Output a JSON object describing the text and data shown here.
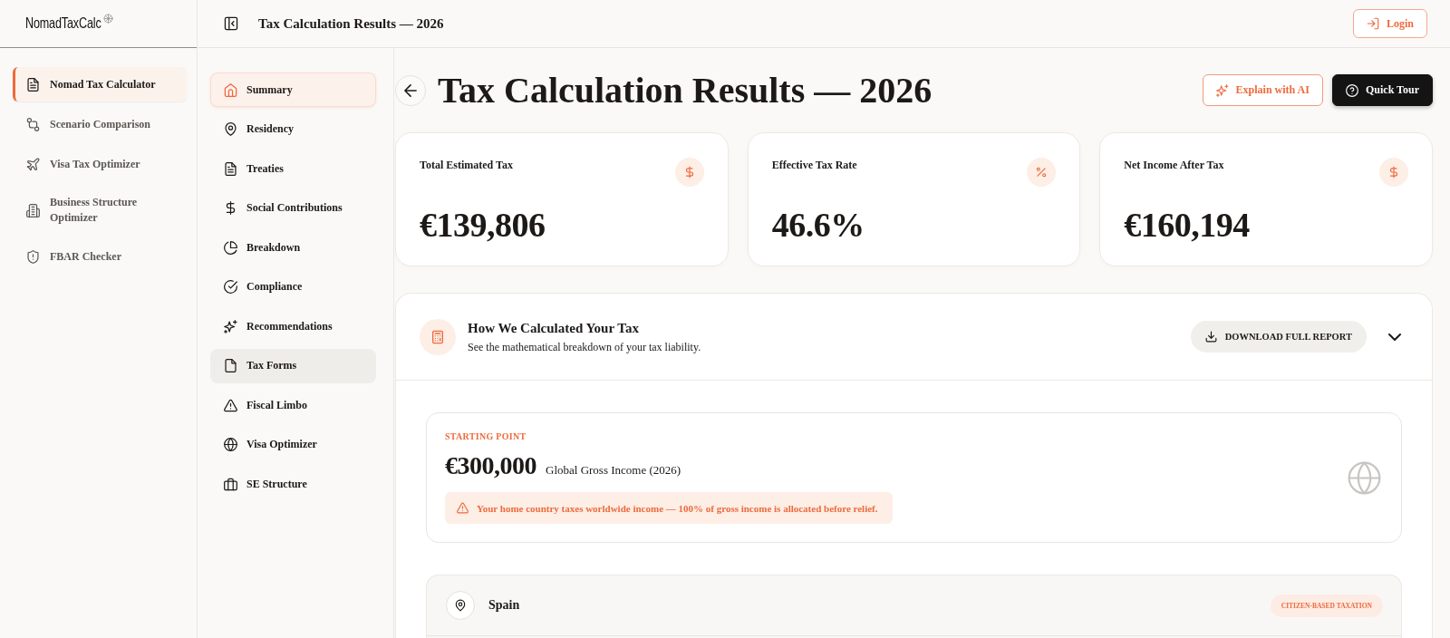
{
  "sidebar": {
    "logo": "NomadTaxCalc",
    "items": [
      {
        "label": "Nomad Tax Calculator",
        "selected": true
      },
      {
        "label": "Scenario Comparison",
        "selected": false
      },
      {
        "label": "Visa Tax Optimizer",
        "selected": false
      },
      {
        "label": "Business Structure Optimizer",
        "selected": false
      },
      {
        "label": "FBAR Checker",
        "selected": false
      }
    ]
  },
  "header": {
    "title": "Tax Calculation Results — 2026",
    "login_button": "Login"
  },
  "section_nav": {
    "items": [
      {
        "label": "Summary",
        "selected": true,
        "hovered": false
      },
      {
        "label": "Residency",
        "selected": false,
        "hovered": false
      },
      {
        "label": "Treaties",
        "selected": false,
        "hovered": false
      },
      {
        "label": "Social Contributions",
        "selected": false,
        "hovered": false
      },
      {
        "label": "Breakdown",
        "selected": false,
        "hovered": false
      },
      {
        "label": "Compliance",
        "selected": false,
        "hovered": false
      },
      {
        "label": "Recommendations",
        "selected": false,
        "hovered": false
      },
      {
        "label": "Tax Forms",
        "selected": false,
        "hovered": true
      },
      {
        "label": "Fiscal Limbo",
        "selected": false,
        "hovered": false
      },
      {
        "label": "Visa Optimizer",
        "selected": false,
        "hovered": false
      },
      {
        "label": "SE Structure",
        "selected": false,
        "hovered": false
      }
    ]
  },
  "page_title": "Tax Calculation Results — 2026",
  "actions": [
    {
      "label": "Explain with AI",
      "kind": "outline"
    },
    {
      "label": "Quick Tour",
      "kind": "dark"
    }
  ],
  "stat_cards": [
    {
      "label": "Total Estimated Tax",
      "value": "€139,806",
      "kind": "amount"
    },
    {
      "label": "Effective Tax Rate",
      "value": "46.6%",
      "kind": "rate"
    },
    {
      "label": "Net Income After Tax",
      "value": "€160,194",
      "kind": "amount"
    }
  ],
  "calculation": {
    "title": "How We Calculated Your Tax",
    "subtitle": "See the mathematical breakdown of your tax liability.",
    "download_button": "DOWNLOAD FULL REPORT",
    "starting_point": {
      "label": "STARTING POINT",
      "amount": "€300,000",
      "description": "Global Gross Income (2026)",
      "alert": "Your home country taxes worldwide income — 100% of gross income is allocated before relief."
    },
    "countries": [
      {
        "name": "Spain",
        "badge": "CITIZEN-BASED TAXATION"
      }
    ]
  }
}
